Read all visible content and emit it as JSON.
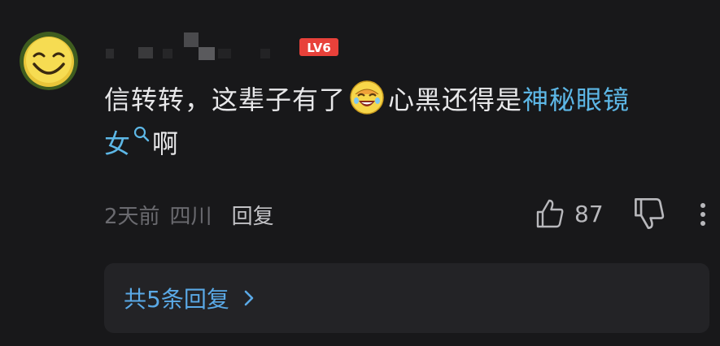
{
  "comment": {
    "username": "",
    "level_badge": "LV6",
    "text": {
      "part1": "信转转，这辈子有了",
      "emoji": "laughing-face",
      "part2": "心黑还得是",
      "link_part1": "神秘眼镜",
      "link_part2": "女",
      "search_icon": "search-icon",
      "tail": "啊"
    },
    "meta": {
      "time": "2天前",
      "location": "四川",
      "reply_label": "回复"
    },
    "likes": {
      "count": "87",
      "like_icon": "thumbs-up-icon",
      "dislike_icon": "thumbs-down-icon"
    },
    "more_icon": "more-vertical-icon"
  },
  "replies": {
    "label": "共5条回复",
    "chevron_icon": "chevron-right-icon"
  },
  "colors": {
    "background": "#18181a",
    "text": "#e8e8ea",
    "link": "#5db7e6",
    "meta": "#6a6a6f",
    "level_badge": "#e8413a",
    "reply_box": "#232326"
  }
}
